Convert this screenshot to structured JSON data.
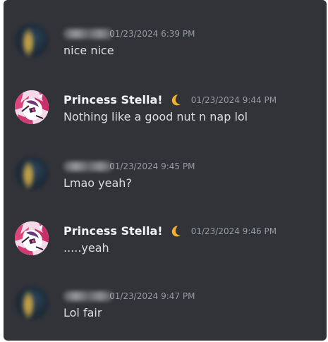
{
  "messages": [
    {
      "author": "",
      "author_redacted": true,
      "avatar_icon": "blurred-avatar-icon",
      "timestamp": "01/23/2024 6:39 PM",
      "text": "nice nice"
    },
    {
      "author": "Princess Stella!",
      "author_redacted": false,
      "author_badge_icon": "crescent-moon-icon",
      "avatar_icon": "anime-character-avatar-icon",
      "timestamp": "01/23/2024 9:44 PM",
      "text": "Nothing like a good nut n nap lol"
    },
    {
      "author": "",
      "author_redacted": true,
      "avatar_icon": "blurred-avatar-icon",
      "timestamp": "01/23/2024 9:45 PM",
      "text": "Lmao yeah?"
    },
    {
      "author": "Princess Stella!",
      "author_redacted": false,
      "author_badge_icon": "crescent-moon-icon",
      "avatar_icon": "anime-character-avatar-icon",
      "timestamp": "01/23/2024 9:46 PM",
      "text": ".....yeah"
    },
    {
      "author": "",
      "author_redacted": true,
      "avatar_icon": "blurred-avatar-icon",
      "timestamp": "01/23/2024 9:47 PM",
      "text": "Lol fair"
    }
  ],
  "colors": {
    "background": "#313338",
    "username": "#f2f3f5",
    "timestamp": "#949ba4",
    "message_text": "#dbdee1",
    "moon": "#f0b232"
  }
}
